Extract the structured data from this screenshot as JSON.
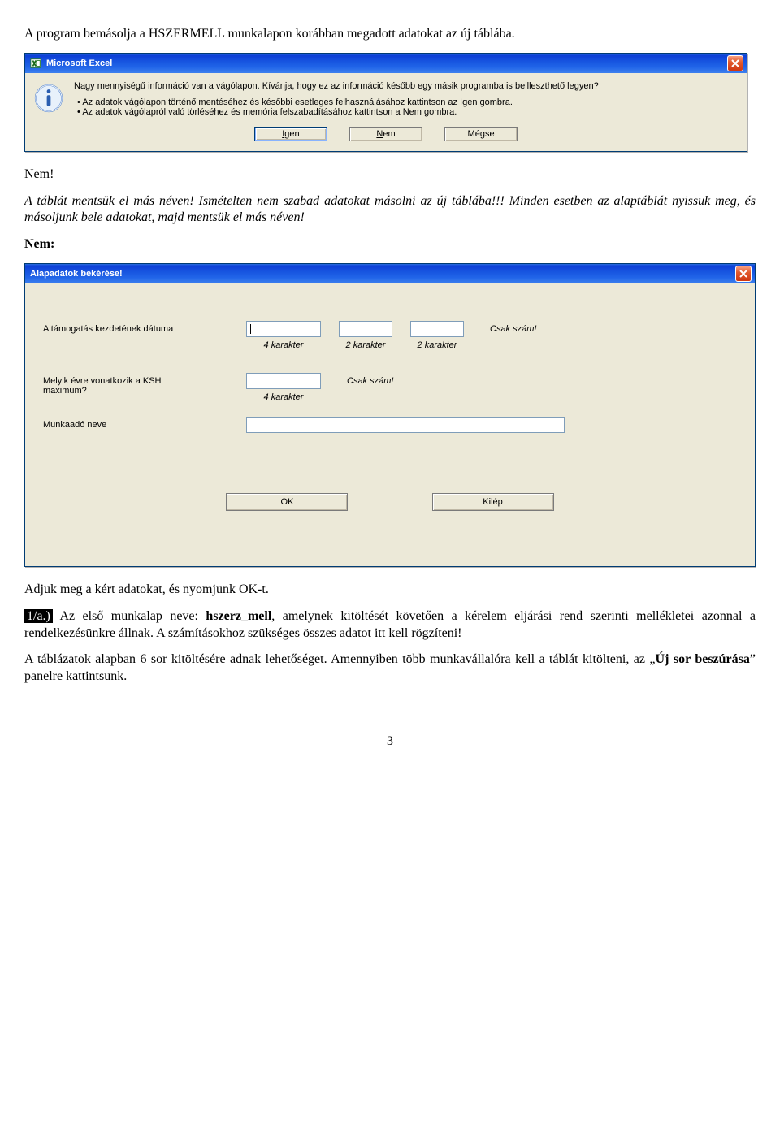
{
  "para1": "A program bemásolja a HSZERMELL munkalapon korábban megadott adatokat az új táblába.",
  "dlg1": {
    "title": "Microsoft Excel",
    "question": "Nagy mennyiségű információ van a vágólapon. Kívánja, hogy ez az információ később egy másik programba is beilleszthető legyen?",
    "b1": "Az adatok vágólapon történő mentéséhez és későbbi esetleges felhasználásához kattintson az Igen gombra.",
    "b2": "Az adatok vágólapról való törléséhez és memória felszabadításához kattintson a Nem gombra.",
    "btn_yes": "Igen",
    "btn_no": "Nem",
    "btn_cancel": "Mégse"
  },
  "para2": "Nem!",
  "para3": "A táblát mentsük el más néven! Ismételten nem szabad adatokat másolni az új táblába!!! Minden esetben az alaptáblát nyissuk meg, és másoljunk bele adatokat, majd mentsük el más néven!",
  "para4": "Nem:",
  "dlg2": {
    "title": "Alapadatok bekérése!",
    "row1_label": "A támogatás kezdetének dátuma",
    "row1_hint": "Csak szám!",
    "cap4": "4 karakter",
    "cap2": "2 karakter",
    "row2_label_a": "Melyik évre vonatkozik a KSH",
    "row2_label_b": "maximum?",
    "row2_hint": "Csak szám!",
    "row3_label": "Munkaadó neve",
    "btn_ok": "OK",
    "btn_exit": "Kilép"
  },
  "para5": "Adjuk meg a kért adatokat, és nyomjunk OK-t.",
  "para6_hl": "1/a.)",
  "para6_a": " Az első munkalap neve: ",
  "para6_b": "hszerz_mell",
  "para6_c": ", amelynek kitöltését követően a kérelem eljárási rend szerinti mellékletei azonnal a rendelkezésünkre állnak. ",
  "para6_d": "A számításokhoz szükséges összes adatot itt kell rögzíteni!",
  "para7_a": "A táblázatok alapban 6 sor kitöltésére adnak lehetőséget. Amennyiben több munkavállalóra kell a táblát kitölteni, az „",
  "para7_b": "Új sor beszúrása",
  "para7_c": "” panelre kattintsunk.",
  "pagenum": "3"
}
